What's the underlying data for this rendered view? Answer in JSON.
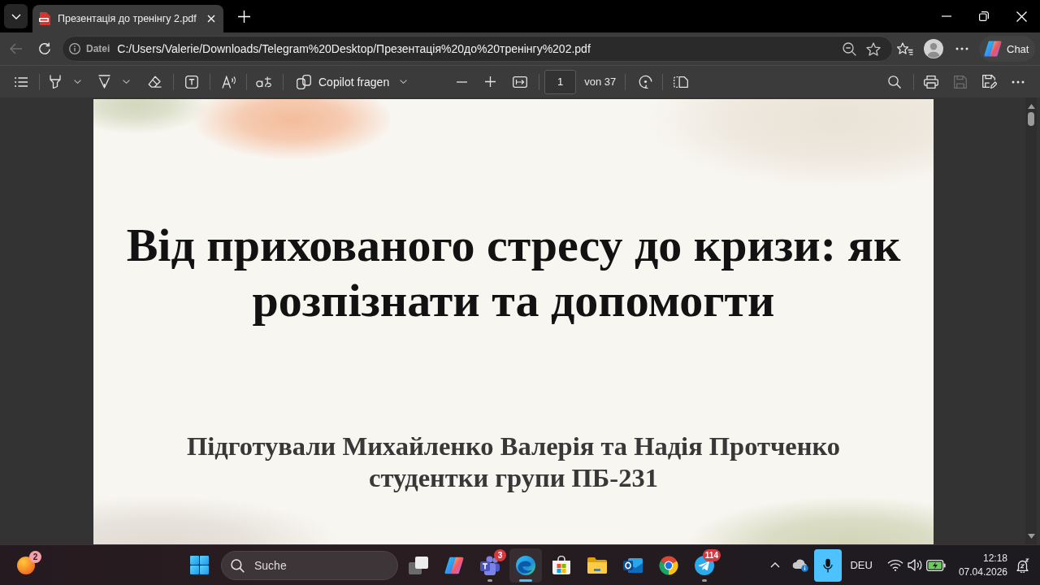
{
  "tab_strip": {
    "tabs": [
      {
        "title": "Презентація до тренінгу 2.pdf",
        "selected": true
      }
    ]
  },
  "address_bar": {
    "back_disabled": true,
    "scheme": "Datei",
    "url": "C:/Users/Valerie/Downloads/Telegram%20Desktop/Презентація%20до%20тренінгу%202.pdf"
  },
  "browser_toolbar": {
    "chat_label": "Chat"
  },
  "pdf_toolbar": {
    "copilot_label": "Copilot fragen",
    "page_number": "1",
    "page_count": "von 37",
    "save_disabled": true
  },
  "document": {
    "title": "Від прихованого стресу до кризи: як розпізнати та допомогти",
    "authors": "Підготували Михайленко Валерія та Надія Протченко",
    "group": "студентки групи ПБ-231"
  },
  "taskbar": {
    "widgets_badge": "2",
    "search_placeholder": "Suche",
    "apps": [
      {
        "kind": "taskview",
        "running": false,
        "selected": false
      },
      {
        "kind": "copilot",
        "running": false,
        "selected": false
      },
      {
        "kind": "teams",
        "badge": "3",
        "running": true,
        "selected": false
      },
      {
        "kind": "edge",
        "running": true,
        "selected": true
      },
      {
        "kind": "store",
        "running": false,
        "selected": false
      },
      {
        "kind": "files",
        "running": false,
        "selected": false
      },
      {
        "kind": "mail",
        "running": false,
        "selected": false
      },
      {
        "kind": "chrome",
        "running": false,
        "selected": false
      },
      {
        "kind": "telegram",
        "badge": "114",
        "running": true,
        "selected": false
      }
    ],
    "tray": {
      "mic_active": true,
      "language": "DEU",
      "time": "12:18",
      "date": "07.04.2026"
    }
  }
}
